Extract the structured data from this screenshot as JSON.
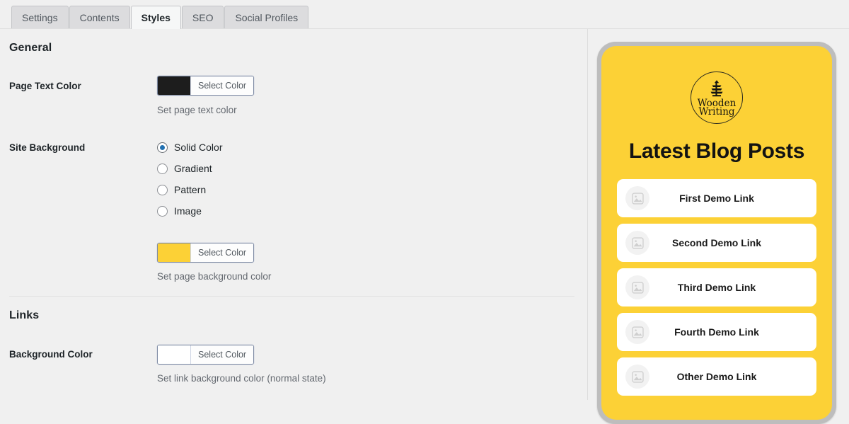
{
  "tabs": [
    {
      "label": "Settings",
      "active": false
    },
    {
      "label": "Contents",
      "active": false
    },
    {
      "label": "Styles",
      "active": true
    },
    {
      "label": "SEO",
      "active": false
    },
    {
      "label": "Social Profiles",
      "active": false
    }
  ],
  "sections": {
    "general": {
      "title": "General",
      "page_text_color": {
        "label": "Page Text Color",
        "button_label": "Select Color",
        "swatch_color": "#1d1d1d",
        "help": "Set page text color"
      },
      "site_background": {
        "label": "Site Background",
        "options": [
          {
            "label": "Solid Color",
            "checked": true
          },
          {
            "label": "Gradient",
            "checked": false
          },
          {
            "label": "Pattern",
            "checked": false
          },
          {
            "label": "Image",
            "checked": false
          }
        ],
        "button_label": "Select Color",
        "swatch_color": "#fcd136",
        "help": "Set page background color"
      }
    },
    "links": {
      "title": "Links",
      "background_color": {
        "label": "Background Color",
        "button_label": "Select Color",
        "swatch_color": "#ffffff",
        "help": "Set link background color (normal state)"
      }
    }
  },
  "preview": {
    "background_color": "#fcd136",
    "logo": {
      "line1": "Wooden",
      "line2": "Writing",
      "icon": "tree-icon"
    },
    "heading": "Latest Blog Posts",
    "cards": [
      {
        "title": "First Demo Link",
        "thumb_icon": "image-placeholder-icon"
      },
      {
        "title": "Second Demo Link",
        "thumb_icon": "image-placeholder-icon"
      },
      {
        "title": "Third Demo Link",
        "thumb_icon": "image-placeholder-icon"
      },
      {
        "title": "Fourth Demo Link",
        "thumb_icon": "image-placeholder-icon"
      },
      {
        "title": "Other Demo Link",
        "thumb_icon": "image-placeholder-icon"
      }
    ]
  }
}
